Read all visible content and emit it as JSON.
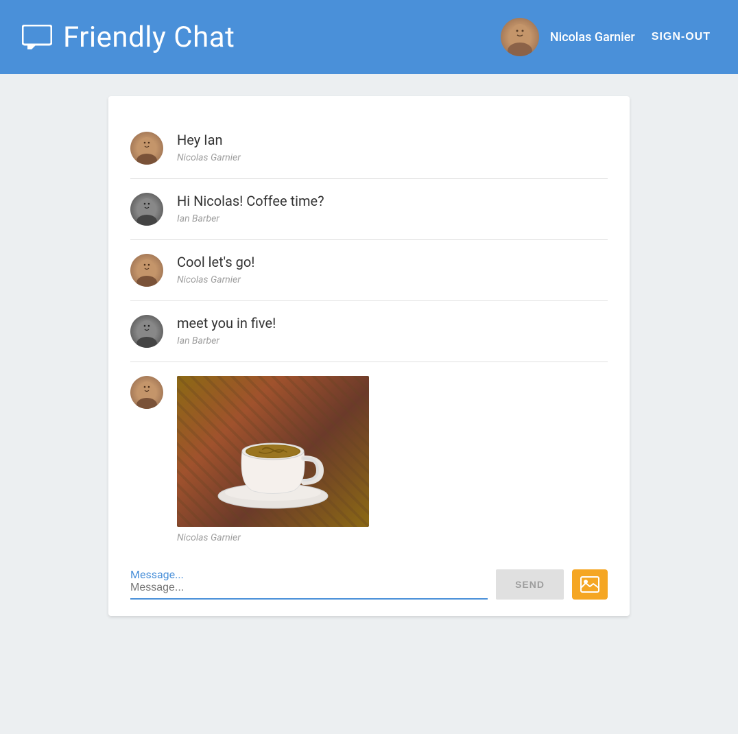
{
  "header": {
    "title": "Friendly Chat",
    "user": {
      "name": "Nicolas Garnier",
      "avatar_alt": "Nicolas Garnier avatar"
    },
    "sign_out_label": "SIGN-OUT"
  },
  "chat": {
    "messages": [
      {
        "id": 1,
        "text": "Hey Ian",
        "author": "Nicolas Garnier",
        "avatar_type": "nicolas",
        "has_image": false
      },
      {
        "id": 2,
        "text": "Hi Nicolas! Coffee time?",
        "author": "Ian Barber",
        "avatar_type": "ian",
        "has_image": false
      },
      {
        "id": 3,
        "text": "Cool let's go!",
        "author": "Nicolas Garnier",
        "avatar_type": "nicolas",
        "has_image": false
      },
      {
        "id": 4,
        "text": "meet you in five!",
        "author": "Ian Barber",
        "avatar_type": "ian",
        "has_image": false
      },
      {
        "id": 5,
        "text": "",
        "author": "Nicolas Garnier",
        "avatar_type": "nicolas",
        "has_image": true
      }
    ],
    "input": {
      "placeholder": "Message...",
      "value": ""
    },
    "send_label": "SEND"
  }
}
